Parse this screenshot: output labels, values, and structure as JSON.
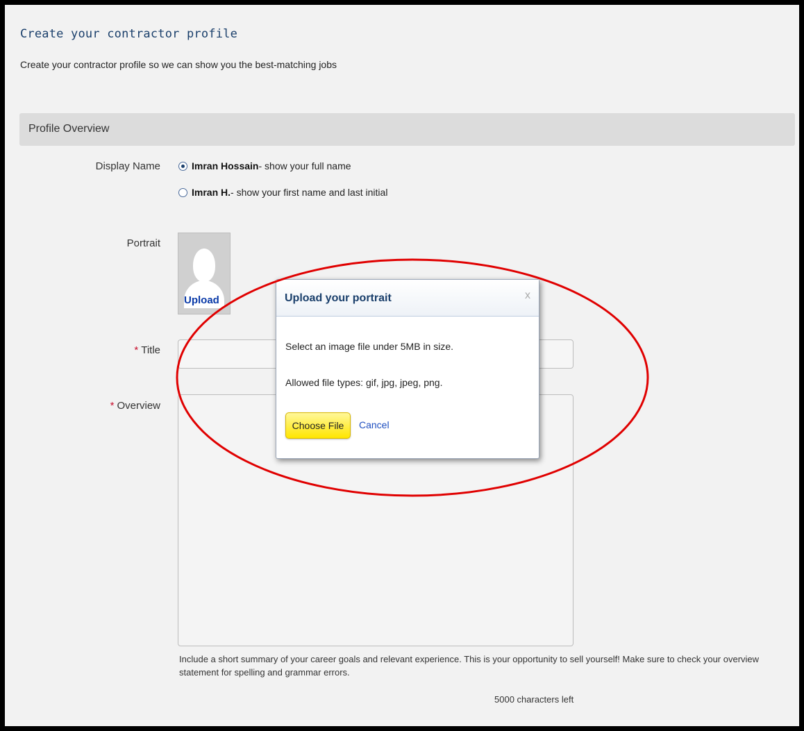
{
  "page": {
    "title": "Create your contractor profile",
    "subtitle": "Create your contractor profile so we can show you the best-matching jobs"
  },
  "section": {
    "title": "Profile Overview"
  },
  "display_name": {
    "label": "Display Name",
    "options": [
      {
        "name": "Imran Hossain",
        "suffix": " - show your full name",
        "selected": true
      },
      {
        "name": "Imran H.",
        "suffix": " - show your first name and last initial",
        "selected": false
      }
    ]
  },
  "portrait": {
    "label": "Portrait",
    "upload_label": "Upload"
  },
  "title_field": {
    "required_mark": "*",
    "label": "Title",
    "value": ""
  },
  "overview_field": {
    "required_mark": "*",
    "label": "Overview",
    "value": "",
    "help": "Include a short summary of your career goals and relevant experience. This is your opportunity to sell yourself! Make sure to check your overview statement for spelling and grammar errors.",
    "chars_left": "5000 characters left"
  },
  "modal": {
    "title": "Upload your portrait",
    "close": "x",
    "line1": "Select an image file under 5MB in size.",
    "line2": "Allowed file types: gif, jpg, jpeg, png.",
    "choose_label": "Choose File",
    "cancel_label": "Cancel"
  },
  "colors": {
    "accent": "#1a3f6b",
    "required": "#c8102e",
    "button": "#ffe600",
    "annotation": "#e00000"
  }
}
